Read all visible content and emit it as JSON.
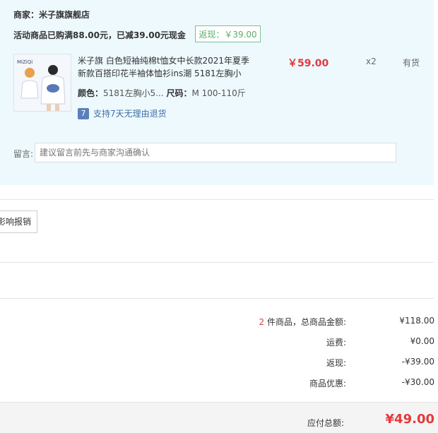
{
  "store": {
    "seller_label": "商家：米子旗旗舰店",
    "promo_text": "活动商品已购满88.00元，已减39.00元现金",
    "promo_tag": "返现：￥39.00"
  },
  "product": {
    "brand_text": "MiZiQi",
    "title": "米子旗 白色短袖纯棉t恤女中长款2021年夏季新款百搭印花半袖体恤衫ins潮 5181左胸小",
    "color_label": "颜色：",
    "color_value": "5181左胸小5...",
    "size_label": "尺码：",
    "size_value": "M 100-110斤",
    "return_icon": "7",
    "return_text": "支持7天无理由退货",
    "price": "￥59.00",
    "qty": "x2",
    "stock": "有货"
  },
  "message": {
    "label": "留言:",
    "placeholder": "建议留言前先与商家沟通确认"
  },
  "invoice": {
    "button": "影响报销"
  },
  "summary": {
    "count": "2",
    "count_suffix": " 件商品，总商品金额:",
    "goods_total": "¥118.00",
    "shipping_label": "运费:",
    "shipping": "¥0.00",
    "cashback_label": "返现:",
    "cashback": "-¥39.00",
    "discount_label": "商品优惠:",
    "discount": "-¥30.00",
    "payable_label": "应付总额:",
    "payable": "¥49.00"
  },
  "colors": {
    "accent_red": "#e4393c",
    "panel_bg": "#eef9fe",
    "promo_green": "#5aae66"
  }
}
